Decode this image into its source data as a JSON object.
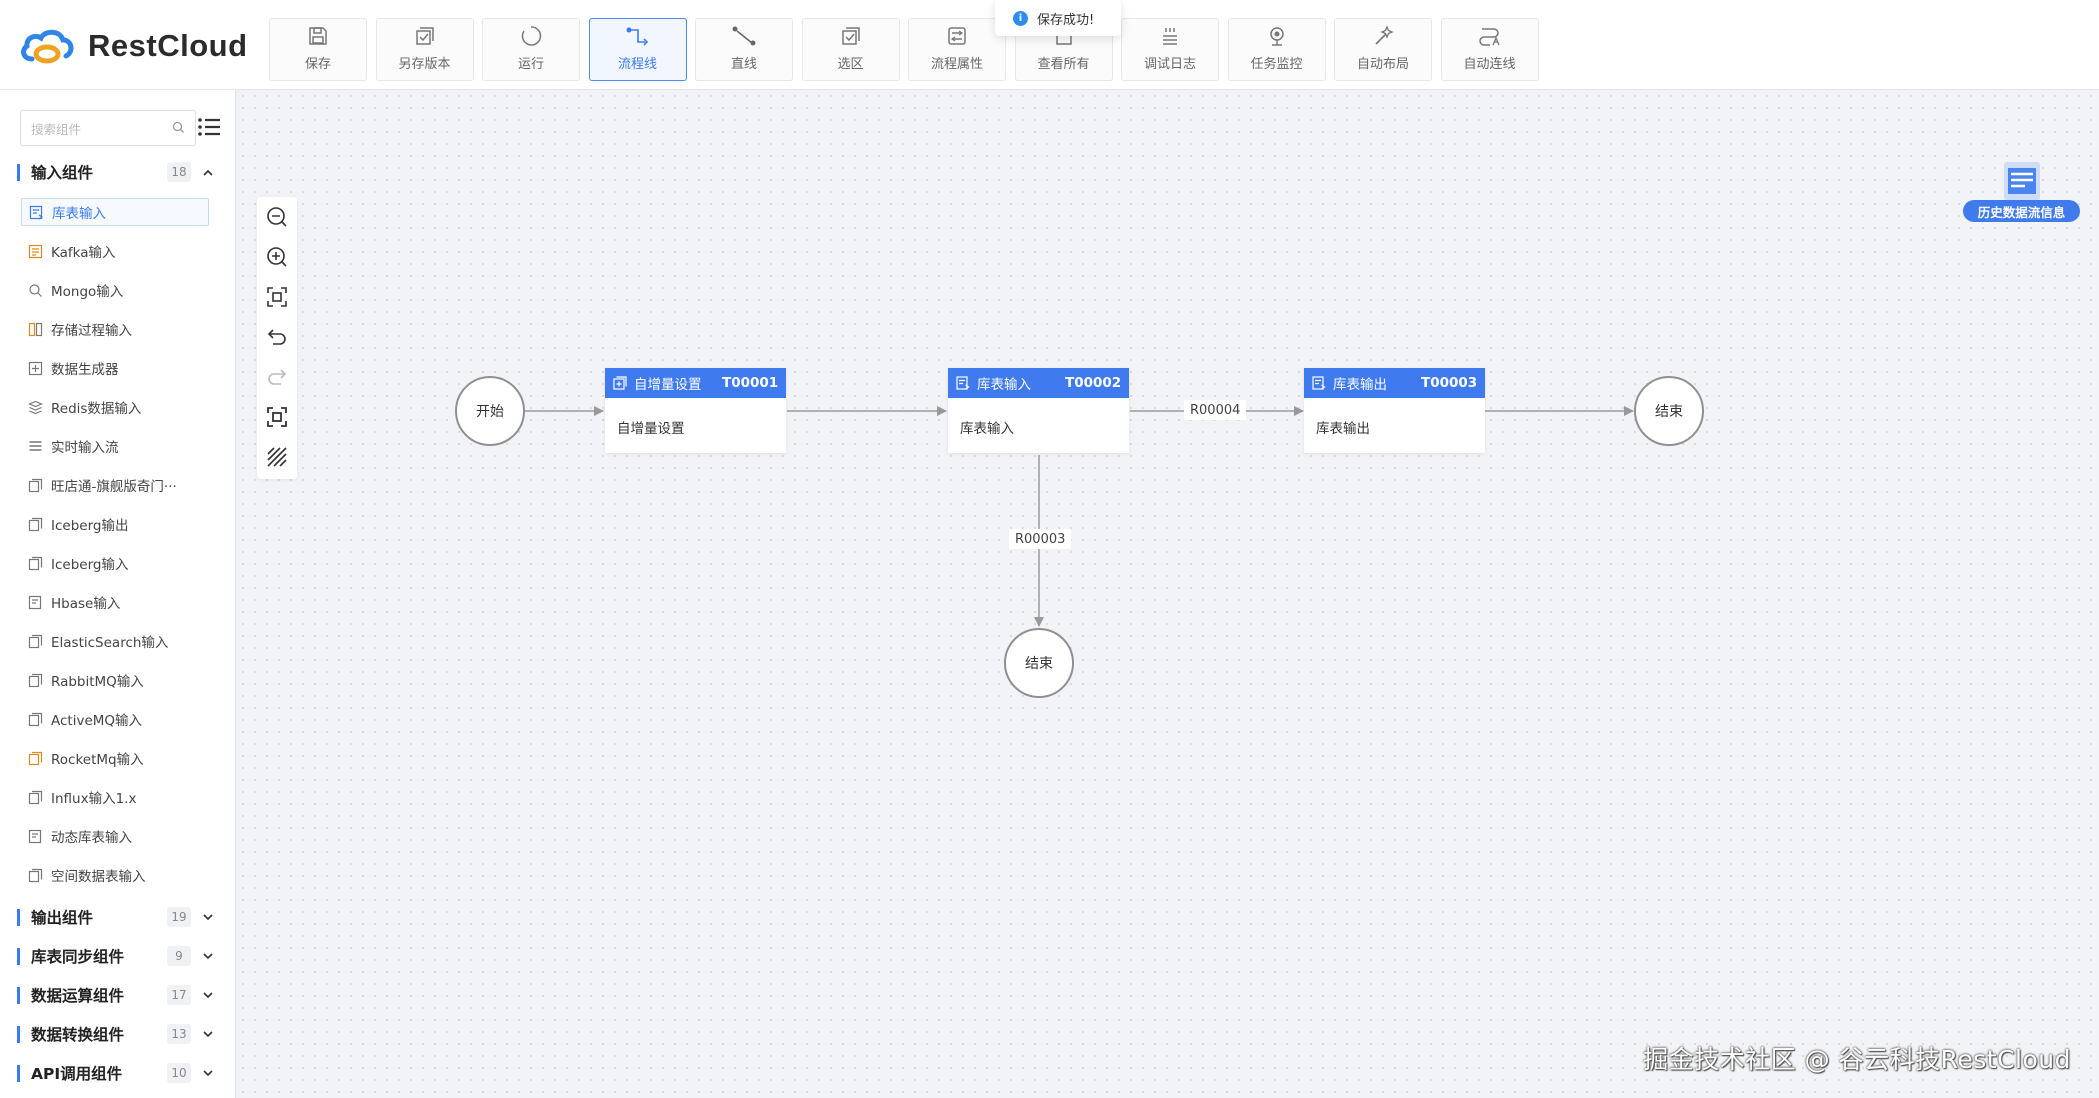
{
  "app": {
    "name": "RestCloud"
  },
  "toolbar": [
    {
      "label": "保存",
      "icon": "save-icon"
    },
    {
      "label": "另存版本",
      "icon": "save-as-icon"
    },
    {
      "label": "运行",
      "icon": "run-icon"
    },
    {
      "label": "流程线",
      "icon": "flow-line-icon",
      "active": true
    },
    {
      "label": "直线",
      "icon": "straight-line-icon"
    },
    {
      "label": "选区",
      "icon": "select-area-icon"
    },
    {
      "label": "流程属性",
      "icon": "process-properties-icon"
    },
    {
      "label": "查看所有",
      "icon": "view-all-icon"
    },
    {
      "label": "调试日志",
      "icon": "debug-log-icon"
    },
    {
      "label": "任务监控",
      "icon": "task-monitor-icon"
    },
    {
      "label": "自动布局",
      "icon": "auto-layout-icon"
    },
    {
      "label": "自动连线",
      "icon": "auto-connect-icon"
    }
  ],
  "toast": {
    "message": "保存成功!",
    "icon": "info-icon"
  },
  "sidebar": {
    "search_placeholder": "搜索组件",
    "groups": [
      {
        "name": "输入组件",
        "count": "18",
        "expanded": true,
        "items": [
          {
            "label": "库表输入",
            "selected": true
          },
          {
            "label": "Kafka输入"
          },
          {
            "label": "Mongo输入"
          },
          {
            "label": "存储过程输入"
          },
          {
            "label": "数据生成器"
          },
          {
            "label": "Redis数据输入"
          },
          {
            "label": "实时输入流"
          },
          {
            "label": "旺店通-旗舰版奇门···"
          },
          {
            "label": "Iceberg输出"
          },
          {
            "label": "Iceberg输入"
          },
          {
            "label": "Hbase输入"
          },
          {
            "label": "ElasticSearch输入"
          },
          {
            "label": "RabbitMQ输入"
          },
          {
            "label": "ActiveMQ输入"
          },
          {
            "label": "RocketMq输入"
          },
          {
            "label": "Influx输入1.x"
          },
          {
            "label": "动态库表输入"
          },
          {
            "label": "空间数据表输入"
          }
        ]
      },
      {
        "name": "输出组件",
        "count": "19",
        "expanded": false
      },
      {
        "name": "库表同步组件",
        "count": "9",
        "expanded": false
      },
      {
        "name": "数据运算组件",
        "count": "17",
        "expanded": false
      },
      {
        "name": "数据转换组件",
        "count": "13",
        "expanded": false
      },
      {
        "name": "API调用组件",
        "count": "10",
        "expanded": false
      }
    ]
  },
  "canvas": {
    "zoom_tools": [
      "zoom-out-icon",
      "zoom-in-icon",
      "fit-view-icon",
      "undo-icon",
      "redo-icon",
      "actual-size-icon",
      "grid-toggle-icon"
    ],
    "history_label": "历史数据流信息",
    "nodes": {
      "start": "开始",
      "end_right": "结束",
      "end_bottom": "结束",
      "task1": {
        "name": "自增量设置",
        "id": "T00001",
        "body": "自增量设置"
      },
      "task2": {
        "name": "库表输入",
        "id": "T00002",
        "body": "库表输入"
      },
      "task3": {
        "name": "库表输出",
        "id": "T00003",
        "body": "库表输出"
      }
    },
    "edges": {
      "r4": "R00004",
      "r3": "R00003"
    }
  },
  "watermark": "掘金技术社区 @ 谷云科技RestCloud",
  "colors": {
    "accent": "#3f7bef",
    "selected_border": "#4a8af4"
  }
}
